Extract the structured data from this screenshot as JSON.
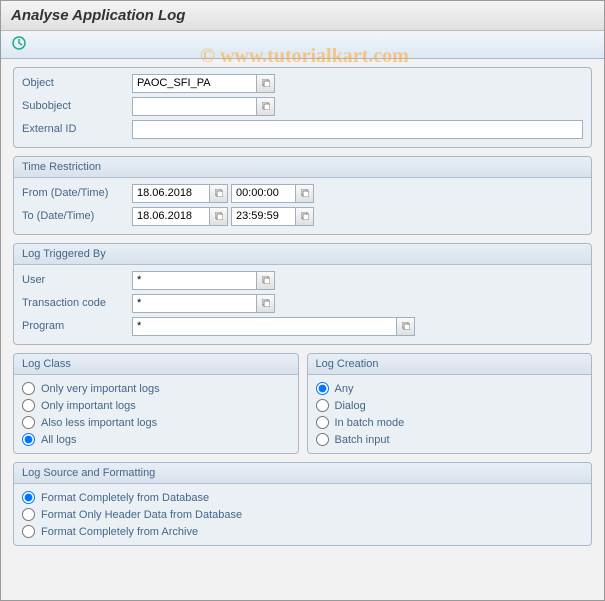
{
  "title": "Analyse Application Log",
  "watermark": "© www.tutorialkart.com",
  "fields": {
    "object_label": "Object",
    "object_value": "PAOC_SFI_PA",
    "subobject_label": "Subobject",
    "subobject_value": "",
    "external_id_label": "External ID",
    "external_id_value": ""
  },
  "time_restriction": {
    "header": "Time Restriction",
    "from_label": "From (Date/Time)",
    "from_date": "18.06.2018",
    "from_time": "00:00:00",
    "to_label": "To (Date/Time)",
    "to_date": "18.06.2018",
    "to_time": "23:59:59"
  },
  "log_triggered": {
    "header": "Log Triggered By",
    "user_label": "User",
    "user_value": "*",
    "tcode_label": "Transaction code",
    "tcode_value": "*",
    "program_label": "Program",
    "program_value": "*"
  },
  "log_class": {
    "header": "Log Class",
    "options": {
      "very_important": "Only very important logs",
      "important": "Only important logs",
      "less_important": "Also less important logs",
      "all": "All logs"
    },
    "selected": "all"
  },
  "log_creation": {
    "header": "Log Creation",
    "options": {
      "any": "Any",
      "dialog": "Dialog",
      "batch": "In batch mode",
      "batch_input": "Batch input"
    },
    "selected": "any"
  },
  "log_source": {
    "header": "Log Source and Formatting",
    "options": {
      "db_full": "Format Completely from Database",
      "db_header": "Format Only Header Data from Database",
      "archive": "Format Completely from Archive"
    },
    "selected": "db_full"
  }
}
